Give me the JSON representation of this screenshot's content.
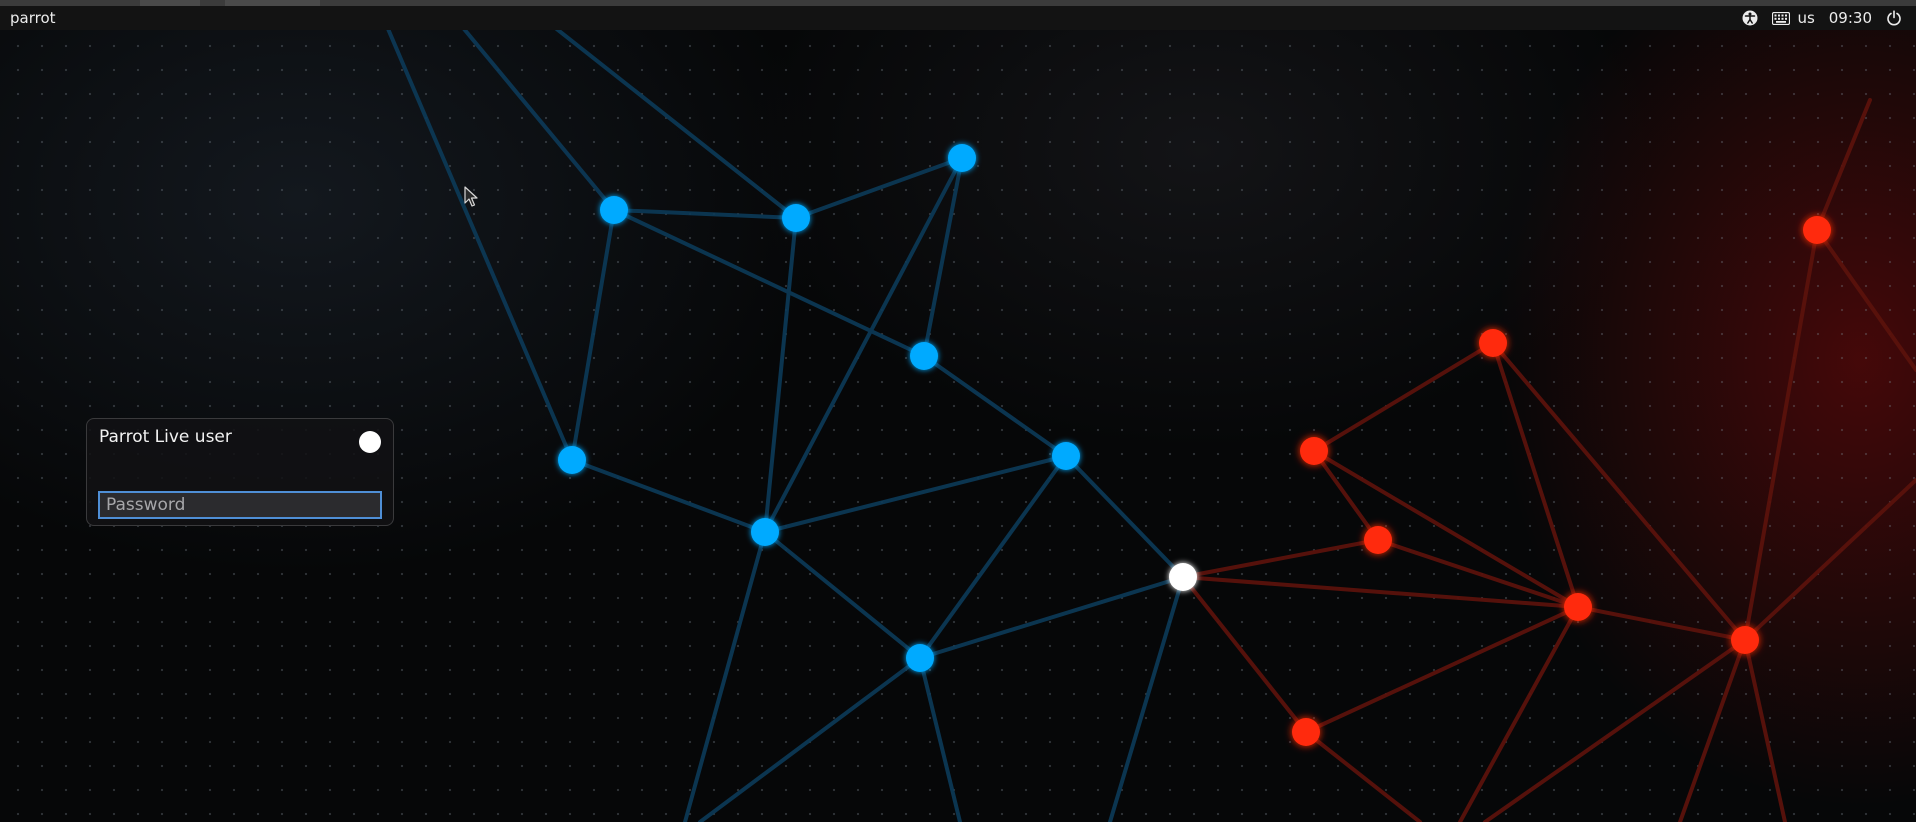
{
  "topbar": {
    "hostname": "parrot",
    "keyboard_layout": "us",
    "clock": "09:30",
    "icons": [
      "accessibility-icon",
      "keyboard-icon",
      "power-icon"
    ]
  },
  "login": {
    "user_name": "Parrot Live user",
    "password_placeholder": "Password",
    "password_value": ""
  },
  "colors": {
    "blue_node": "#00aaff",
    "red_node": "#ff2a0a",
    "white_node": "#ffffff",
    "focus_border": "#4f8fd6"
  }
}
